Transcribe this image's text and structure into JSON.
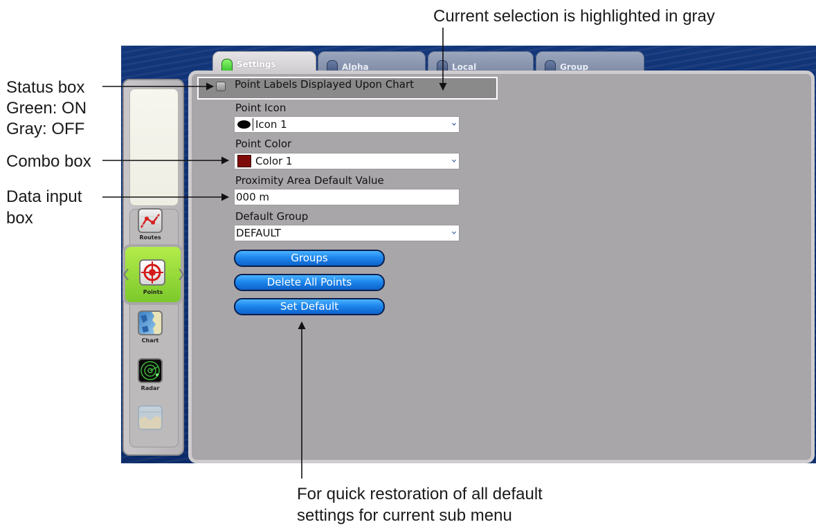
{
  "callouts": {
    "top": "Current selection is highlighted in gray",
    "status_line1": "Status box",
    "status_line2": "Green: ON",
    "status_line3": "Gray: OFF",
    "combo": "Combo box",
    "data_line1": "Data input",
    "data_line2": "box",
    "bottom_line1": "For quick restoration of all default",
    "bottom_line2": "settings for current sub menu"
  },
  "tabs": [
    {
      "label": "Settings",
      "active": true
    },
    {
      "label": "Alpha",
      "active": false
    },
    {
      "label": "Local",
      "active": false
    },
    {
      "label": "Group",
      "active": false
    }
  ],
  "sidebar": {
    "items": [
      {
        "label": "Routes",
        "icon": "route-icon"
      },
      {
        "label": "Points",
        "icon": "target-icon",
        "selected": true
      },
      {
        "label": "Chart",
        "icon": "chart-icon"
      },
      {
        "label": "Radar",
        "icon": "radar-icon"
      },
      {
        "label": "",
        "icon": "map-icon"
      }
    ]
  },
  "settings": {
    "toggle_label": "Point Labels Displayed Upon Chart",
    "toggle_state": "off",
    "point_icon": {
      "label": "Point Icon",
      "value": "Icon 1"
    },
    "point_color": {
      "label": "Point Color",
      "value": "Color 1",
      "swatch": "#7e0a0a"
    },
    "proximity": {
      "label": "Proximity Area Default Value",
      "value": "000 m"
    },
    "default_group": {
      "label": "Default Group",
      "value": "DEFAULT"
    },
    "buttons": {
      "groups": "Groups",
      "delete_all": "Delete All Points",
      "set_default": "Set Default"
    }
  },
  "colors": {
    "button_blue": "#1e86ec",
    "panel_gray": "#a9a6a9",
    "status_on": "#2fbf2a",
    "background_blue": "#0d2e70"
  }
}
